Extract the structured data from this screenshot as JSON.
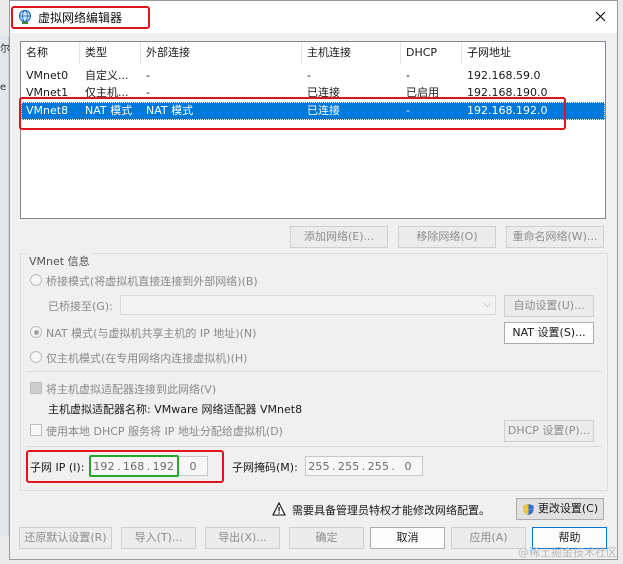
{
  "window": {
    "title": "虚拟网络编辑器"
  },
  "table": {
    "headers": [
      "名称",
      "类型",
      "外部连接",
      "主机连接",
      "DHCP",
      "子网地址"
    ],
    "rows": [
      [
        "VMnet0",
        "自定义...",
        "-",
        "-",
        "-",
        "192.168.59.0"
      ],
      [
        "VMnet1",
        "仅主机...",
        "-",
        "已连接",
        "已启用",
        "192.168.190.0"
      ],
      [
        "VMnet8",
        "NAT 模式",
        "NAT 模式",
        "已连接",
        "-",
        "192.168.192.0"
      ]
    ],
    "selected_index": 2
  },
  "table_buttons": {
    "add": "添加网络(E)...",
    "remove": "移除网络(O)",
    "rename": "重命名网络(W)..."
  },
  "vmnet_info": {
    "label": "VMnet 信息",
    "bridge_option": "桥接模式(将虚拟机直接连接到外部网络)(B)",
    "bridged_to_label": "已桥接至(G):",
    "auto_settings": "自动设置(U)...",
    "nat_option": "NAT 模式(与虚拟机共享主机的 IP 地址)(N)",
    "nat_settings": "NAT 设置(S)...",
    "host_only_option": "仅主机模式(在专用网络内连接虚拟机)(H)",
    "connect_adapter": "将主机虚拟适配器连接到此网络(V)",
    "adapter_name_label": "主机虚拟适配器名称: VMware 网络适配器 VMnet8",
    "use_dhcp": "使用本地 DHCP 服务将 IP 地址分配给虚拟机(D)",
    "dhcp_settings": "DHCP 设置(P)...",
    "subnet_ip_label": "子网 IP (I):",
    "subnet_ip": [
      "192",
      "168",
      "192",
      "0"
    ],
    "subnet_mask_label": "子网掩码(M):",
    "subnet_mask": [
      "255",
      "255",
      "255",
      "0"
    ]
  },
  "admin": {
    "warning": "需要具备管理员特权才能修改网络配置。",
    "change_settings": "更改设置(C)"
  },
  "footer": {
    "restore": "还原默认设置(R)",
    "import": "导入(T)...",
    "export": "导出(X)...",
    "ok": "确定",
    "cancel": "取消",
    "apply": "应用(A)",
    "help": "帮助"
  },
  "background": {
    "frag1": "尔",
    "frag2": "e"
  },
  "watermark": "@稀土掘金技术社区",
  "colors": {
    "selection": "#0078d7",
    "highlight_red": "#e0141f",
    "highlight_green": "#22a829"
  }
}
